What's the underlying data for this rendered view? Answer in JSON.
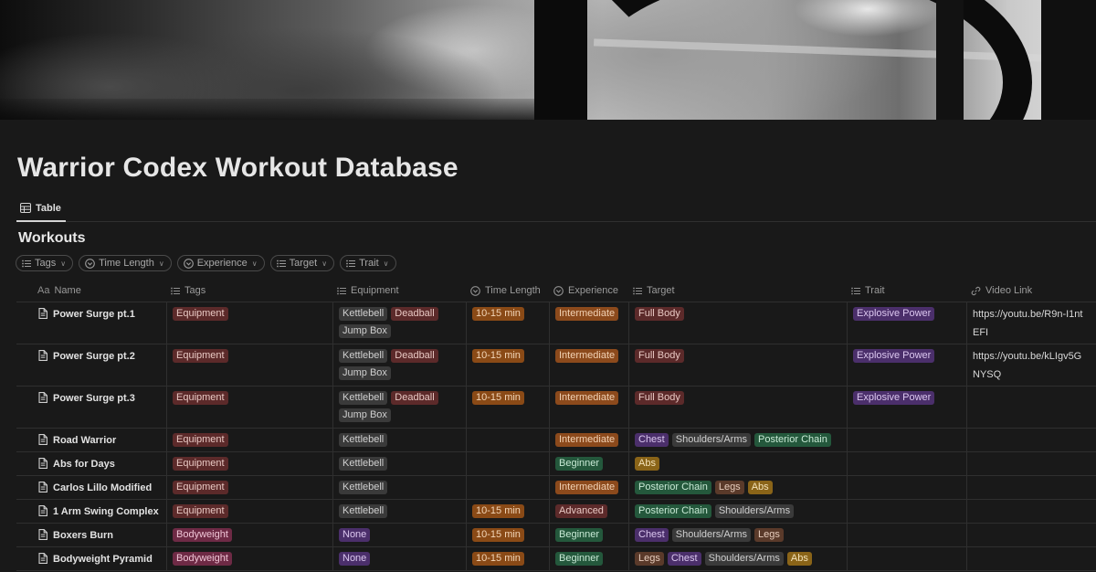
{
  "page": {
    "title": "Warrior Codex Workout Database",
    "view_tab": "Table",
    "database_title": "Workouts"
  },
  "filters": [
    {
      "label": "Tags",
      "icon": "list-icon"
    },
    {
      "label": "Time Length",
      "icon": "select-icon"
    },
    {
      "label": "Experience",
      "icon": "select-icon"
    },
    {
      "label": "Target",
      "icon": "list-icon"
    },
    {
      "label": "Trait",
      "icon": "list-icon"
    }
  ],
  "columns": [
    {
      "key": "name",
      "label": "Name",
      "icon_text": "Aa"
    },
    {
      "key": "tags",
      "label": "Tags",
      "icon": "list-icon"
    },
    {
      "key": "equipment",
      "label": "Equipment",
      "icon": "list-icon"
    },
    {
      "key": "time",
      "label": "Time Length",
      "icon": "select-icon"
    },
    {
      "key": "experience",
      "label": "Experience",
      "icon": "select-icon"
    },
    {
      "key": "target",
      "label": "Target",
      "icon": "list-icon"
    },
    {
      "key": "trait",
      "label": "Trait",
      "icon": "list-icon"
    },
    {
      "key": "video",
      "label": "Video Link",
      "icon": "link-icon"
    }
  ],
  "tag_colors": {
    "Equipment": "red",
    "Bodyweight": "pink",
    "Kettlebell": "gray",
    "Deadball": "red",
    "Jump Box": "gray",
    "None": "purple",
    "10-15 min": "orange",
    "Intermediate": "brown",
    "Beginner": "green",
    "Advanced": "red",
    "Full Body": "red",
    "Chest": "purple",
    "Shoulders/Arms": "gray",
    "Posterior Chain": "green",
    "Abs": "yellow",
    "Legs": "browntag",
    "Explosive Power": "purple"
  },
  "rows": [
    {
      "name": "Power Surge pt.1",
      "tags": [
        "Equipment"
      ],
      "equipment": [
        "Kettlebell",
        "Deadball",
        "Jump Box"
      ],
      "time": [
        "10-15 min"
      ],
      "experience": [
        "Intermediate"
      ],
      "target": [
        "Full Body"
      ],
      "trait": [
        "Explosive Power"
      ],
      "video": "https://youtu.be/R9n-I1ntEFI"
    },
    {
      "name": "Power Surge pt.2",
      "tags": [
        "Equipment"
      ],
      "equipment": [
        "Kettlebell",
        "Deadball",
        "Jump Box"
      ],
      "time": [
        "10-15 min"
      ],
      "experience": [
        "Intermediate"
      ],
      "target": [
        "Full Body"
      ],
      "trait": [
        "Explosive Power"
      ],
      "video": "https://youtu.be/kLIgv5GNYSQ"
    },
    {
      "name": "Power Surge pt.3",
      "tags": [
        "Equipment"
      ],
      "equipment": [
        "Kettlebell",
        "Deadball",
        "Jump Box"
      ],
      "time": [
        "10-15 min"
      ],
      "experience": [
        "Intermediate"
      ],
      "target": [
        "Full Body"
      ],
      "trait": [
        "Explosive Power"
      ],
      "video": ""
    },
    {
      "name": "Road Warrior",
      "tags": [
        "Equipment"
      ],
      "equipment": [
        "Kettlebell"
      ],
      "time": [],
      "experience": [
        "Intermediate"
      ],
      "target": [
        "Chest",
        "Shoulders/Arms",
        "Posterior Chain"
      ],
      "trait": [],
      "video": ""
    },
    {
      "name": "Abs for Days",
      "tags": [
        "Equipment"
      ],
      "equipment": [
        "Kettlebell"
      ],
      "time": [],
      "experience": [
        "Beginner"
      ],
      "target": [
        "Abs"
      ],
      "trait": [],
      "video": ""
    },
    {
      "name": "Carlos Lillo Modified",
      "tags": [
        "Equipment"
      ],
      "equipment": [
        "Kettlebell"
      ],
      "time": [],
      "experience": [
        "Intermediate"
      ],
      "target": [
        "Posterior Chain",
        "Legs",
        "Abs"
      ],
      "trait": [],
      "video": ""
    },
    {
      "name": "1 Arm Swing Complex",
      "tags": [
        "Equipment"
      ],
      "equipment": [
        "Kettlebell"
      ],
      "time": [
        "10-15 min"
      ],
      "experience": [
        "Advanced"
      ],
      "target": [
        "Posterior Chain",
        "Shoulders/Arms"
      ],
      "trait": [],
      "video": ""
    },
    {
      "name": "Boxers Burn",
      "tags": [
        "Bodyweight"
      ],
      "equipment": [
        "None"
      ],
      "time": [
        "10-15 min"
      ],
      "experience": [
        "Beginner"
      ],
      "target": [
        "Chest",
        "Shoulders/Arms",
        "Legs"
      ],
      "trait": [],
      "video": ""
    },
    {
      "name": "Bodyweight Pyramid",
      "tags": [
        "Bodyweight"
      ],
      "equipment": [
        "None"
      ],
      "time": [
        "10-15 min"
      ],
      "experience": [
        "Beginner"
      ],
      "target": [
        "Legs",
        "Chest",
        "Shoulders/Arms",
        "Abs"
      ],
      "trait": [],
      "video": ""
    }
  ]
}
